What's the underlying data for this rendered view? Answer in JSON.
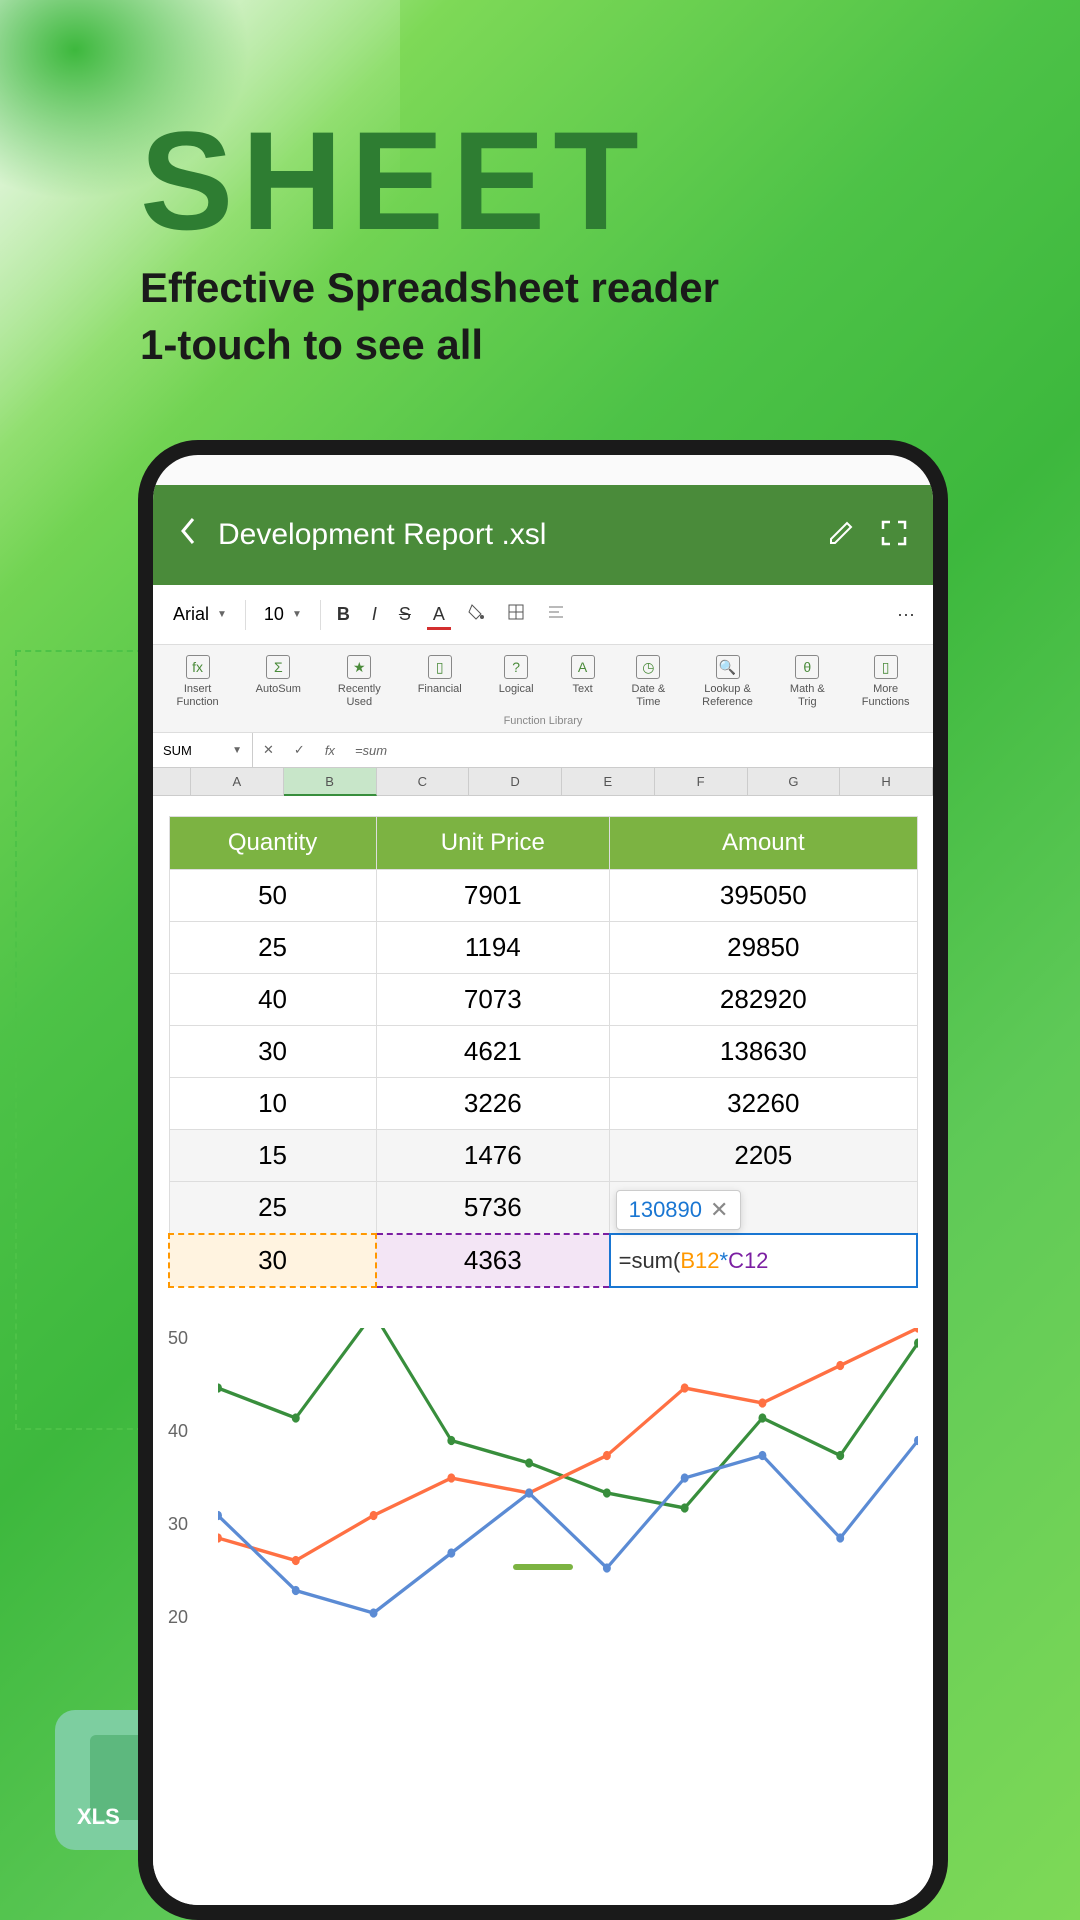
{
  "hero": {
    "title": "SHEET",
    "subtitle_line1": "Effective Spreadsheet reader",
    "subtitle_line2": "1-touch to see all"
  },
  "badge": {
    "text": "XLS"
  },
  "header": {
    "doc_title": "Development Report .xsl"
  },
  "toolbar": {
    "font_name": "Arial",
    "font_size": "10",
    "bold": "B",
    "italic": "I",
    "strike": "S",
    "underline": "A",
    "more": "···"
  },
  "ribbon": {
    "items": [
      {
        "label": "Insert\nFunction"
      },
      {
        "label": "AutoSum"
      },
      {
        "label": "Recently\nUsed"
      },
      {
        "label": "Financial"
      },
      {
        "label": "Logical"
      },
      {
        "label": "Text"
      },
      {
        "label": "Date &\nTime"
      },
      {
        "label": "Lookup &\nReference"
      },
      {
        "label": "Math &\nTrig"
      },
      {
        "label": "More\nFunctions"
      }
    ],
    "group_label": "Function Library"
  },
  "formula_bar": {
    "name_box": "SUM",
    "fx": "fx",
    "formula_text": "=sum"
  },
  "columns": [
    "A",
    "B",
    "C",
    "D",
    "E",
    "F",
    "G",
    "H"
  ],
  "table": {
    "headers": [
      "Quantity",
      "Unit Price",
      "Amount"
    ],
    "rows": [
      [
        "50",
        "7901",
        "395050"
      ],
      [
        "25",
        "1194",
        "29850"
      ],
      [
        "40",
        "7073",
        "282920"
      ],
      [
        "30",
        "4621",
        "138630"
      ],
      [
        "10",
        "3226",
        "32260"
      ],
      [
        "15",
        "1476",
        "2205"
      ],
      [
        "25",
        "5736",
        ""
      ],
      [
        "30",
        "4363",
        ""
      ]
    ],
    "tooltip_value": "130890",
    "formula_display": {
      "prefix": "=sum(",
      "ref1": "B12",
      "star": "*",
      "ref2": "C12"
    }
  },
  "chart_data": {
    "type": "line",
    "ylim": [
      10,
      50
    ],
    "y_ticks": [
      "50",
      "40",
      "30",
      "20"
    ],
    "x": [
      0,
      1,
      2,
      3,
      4,
      5,
      6,
      7,
      8,
      9
    ],
    "series": [
      {
        "name": "green",
        "color": "#388e3c",
        "values": [
          42,
          38,
          52,
          35,
          32,
          28,
          26,
          38,
          33,
          48
        ]
      },
      {
        "name": "orange",
        "color": "#ff7043",
        "values": [
          22,
          19,
          25,
          30,
          28,
          33,
          42,
          40,
          45,
          50
        ]
      },
      {
        "name": "blue",
        "color": "#5b8bd4",
        "values": [
          25,
          15,
          12,
          20,
          28,
          18,
          30,
          33,
          22,
          35
        ]
      }
    ]
  }
}
